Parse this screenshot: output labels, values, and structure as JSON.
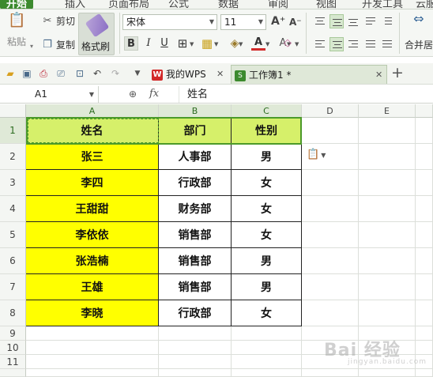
{
  "menu": {
    "tabs": [
      "开始",
      "插入",
      "页面布局",
      "公式",
      "数据",
      "审阅",
      "视图",
      "开发工具",
      "云服"
    ]
  },
  "ribbon": {
    "paste_label": "粘贴",
    "cut_label": "剪切",
    "copy_label": "复制",
    "format_painter_label": "格式刷",
    "font_name": "宋体",
    "font_size": "11",
    "bold": "B",
    "italic": "I",
    "underline": "U",
    "merge_label": "合并居"
  },
  "quickbar": {
    "tabs": [
      {
        "label": "我的WPS",
        "icon": "W"
      },
      {
        "label": "工作簿1 *",
        "icon": "S"
      }
    ]
  },
  "formula_bar": {
    "cell_ref": "A1",
    "fx": "fx",
    "content": "姓名"
  },
  "sheet": {
    "columns": [
      "A",
      "B",
      "C",
      "D",
      "E"
    ],
    "rows": [
      "1",
      "2",
      "3",
      "4",
      "5",
      "6",
      "7",
      "8",
      "9",
      "10",
      "11"
    ],
    "header": [
      "姓名",
      "部门",
      "性别"
    ],
    "records": [
      [
        "张三",
        "人事部",
        "男"
      ],
      [
        "李四",
        "行政部",
        "女"
      ],
      [
        "王甜甜",
        "财务部",
        "女"
      ],
      [
        "李依依",
        "销售部",
        "女"
      ],
      [
        "张浩楠",
        "销售部",
        "男"
      ],
      [
        "王雄",
        "销售部",
        "男"
      ],
      [
        "李晓",
        "行政部",
        "女"
      ]
    ]
  },
  "watermark": {
    "text": "Bai 经验",
    "sub": "jingyan.baidu.com"
  },
  "colors": {
    "accent": "#3c8a2e",
    "name_fill": "#ffff00",
    "header_fill": "#d6f06a"
  }
}
